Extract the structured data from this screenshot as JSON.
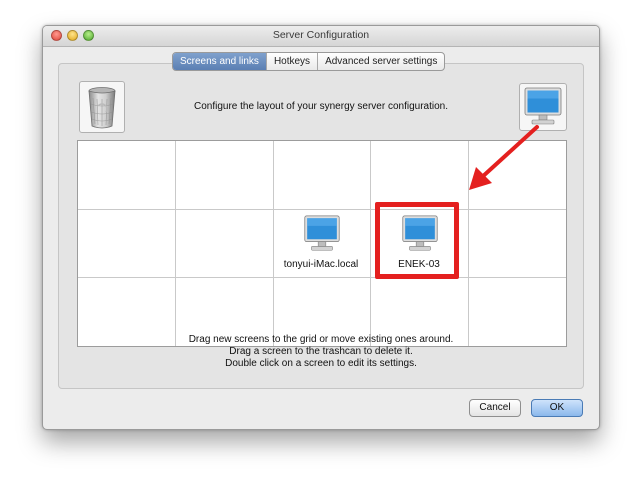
{
  "window": {
    "title": "Server Configuration"
  },
  "tabs": [
    {
      "label": "Screens and links",
      "active": true
    },
    {
      "label": "Hotkeys",
      "active": false
    },
    {
      "label": "Advanced server settings",
      "active": false
    }
  ],
  "instruction": "Configure the layout of your synergy server configuration.",
  "grid": {
    "columns": 5,
    "rows": 3,
    "screens": [
      {
        "name": "tonyui-iMac.local",
        "column": 3,
        "row": 2,
        "highlighted": false
      },
      {
        "name": "ENEK-03",
        "column": 4,
        "row": 2,
        "highlighted": true
      }
    ]
  },
  "help_lines": [
    "Drag new screens to the grid or move existing ones around.",
    "Drag a screen to the trashcan to delete it.",
    "Double click on a screen to edit its settings."
  ],
  "buttons": {
    "cancel": "Cancel",
    "ok": "OK"
  },
  "icons": {
    "trash": "trash-can-icon",
    "new_screen": "monitor-icon",
    "screen": "monitor-icon"
  },
  "colors": {
    "highlight": "#e4201f",
    "tab_active": "#5b7fb3",
    "monitor_screen": "#2f8fd9"
  }
}
